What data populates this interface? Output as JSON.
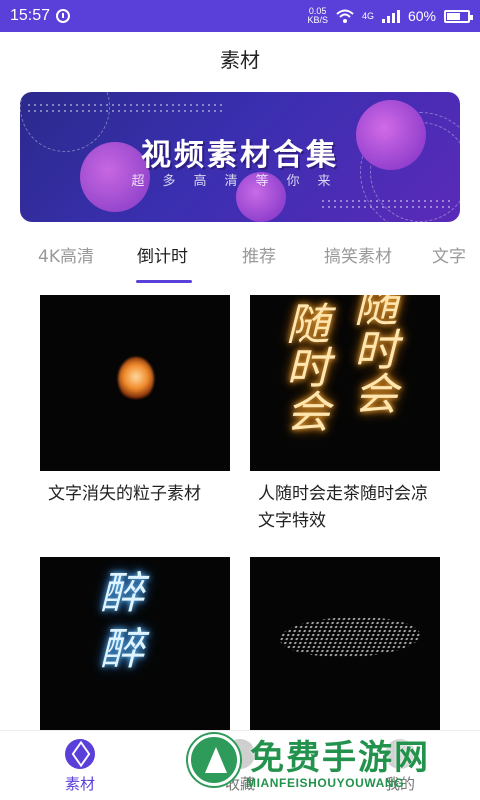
{
  "status_bar": {
    "time": "15:57",
    "speed_value": "0.05",
    "speed_unit": "KB/S",
    "network": "4G",
    "battery": "60%"
  },
  "header": {
    "title": "素材"
  },
  "banner": {
    "headline": "视频素材合集",
    "subline": "超多高清等你来"
  },
  "tabs": [
    {
      "label": "4K高清",
      "active": false
    },
    {
      "label": "倒计时",
      "active": true
    },
    {
      "label": "推荐",
      "active": false
    },
    {
      "label": "搞笑素材",
      "active": false
    },
    {
      "label": "文字",
      "active": false
    }
  ],
  "cards": [
    {
      "caption": "文字消失的粒子素材"
    },
    {
      "caption": "人随时会走茶随时会凉文字特效",
      "thumb_text": "随时会"
    },
    {
      "caption": "",
      "thumb_text": "醉"
    },
    {
      "caption": ""
    }
  ],
  "bottom_nav": [
    {
      "label": "素材",
      "active": true,
      "icon": "cube-icon"
    },
    {
      "label": "收藏",
      "active": false,
      "icon": "star-icon"
    },
    {
      "label": "我的",
      "active": false,
      "icon": "user-icon"
    }
  ],
  "watermark": {
    "title": "免费手游网",
    "subtitle": "MIANFEISHOUYOUWANG"
  },
  "colors": {
    "accent": "#5b3fd9",
    "watermark_green": "#23924d"
  }
}
